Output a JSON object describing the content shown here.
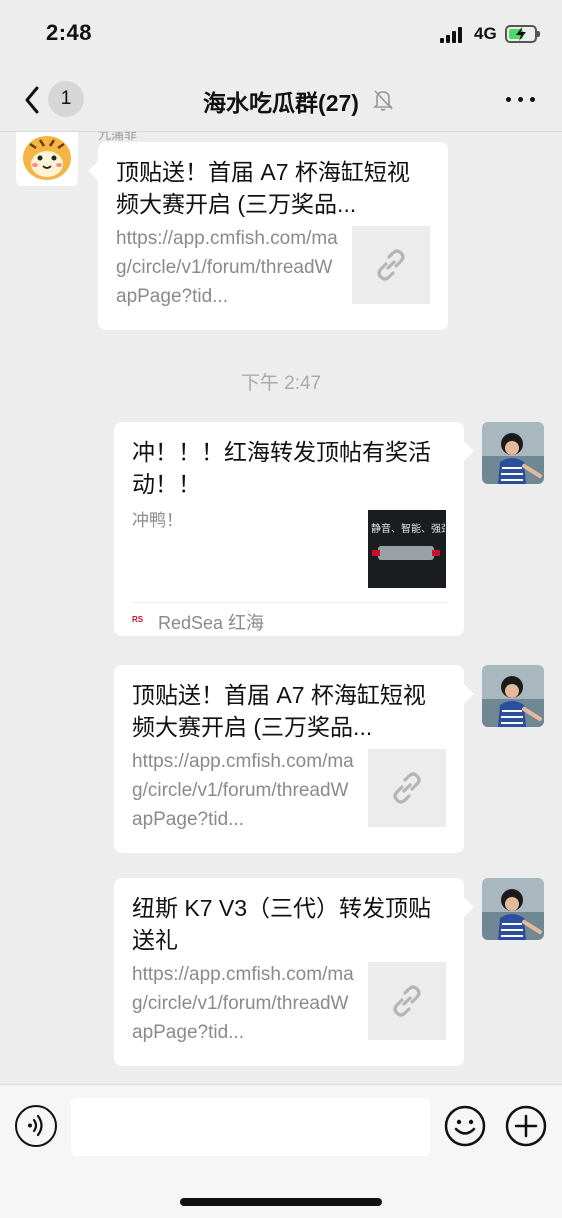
{
  "status_bar": {
    "time": "2:48",
    "network": "4G",
    "colors": {
      "battery_fill": "#4cd964"
    }
  },
  "nav": {
    "back_count": "1",
    "title": "海水吃瓜群(27)",
    "icons": {
      "back": "chevron-left-icon",
      "mute": "bell-slash-icon",
      "more": "more-dots-icon"
    }
  },
  "messages": [
    {
      "side": "left",
      "sender_name": "九蒲菲",
      "title": "顶贴送！首届 A7 杯海缸短视频大赛开启 (三万奖品...",
      "desc": "https://app.cmfish.com/mag/circle/v1/forum/threadWapPage?tid...",
      "thumb_icon": "link-icon"
    },
    {
      "timestamp": "下午 2:47"
    },
    {
      "side": "right",
      "title": "冲！！！红海转发顶帖有奖活动！！",
      "desc": "冲鸭！",
      "thumb_text": "静音、智能、强劲",
      "source": "RedSea 红海"
    },
    {
      "side": "right",
      "title": "顶贴送！首届 A7 杯海缸短视频大赛开启 (三万奖品...",
      "desc": "https://app.cmfish.com/mag/circle/v1/forum/threadWapPage?tid...",
      "thumb_icon": "link-icon"
    },
    {
      "side": "right",
      "title": "纽斯 K7 V3（三代）转发顶贴送礼",
      "desc": "https://app.cmfish.com/mag/circle/v1/forum/threadWapPage?tid...",
      "thumb_icon": "link-icon"
    }
  ],
  "input_bar": {
    "placeholder": "",
    "icons": {
      "voice": "voice-icon",
      "emoji": "emoji-icon",
      "plus": "plus-icon"
    }
  }
}
